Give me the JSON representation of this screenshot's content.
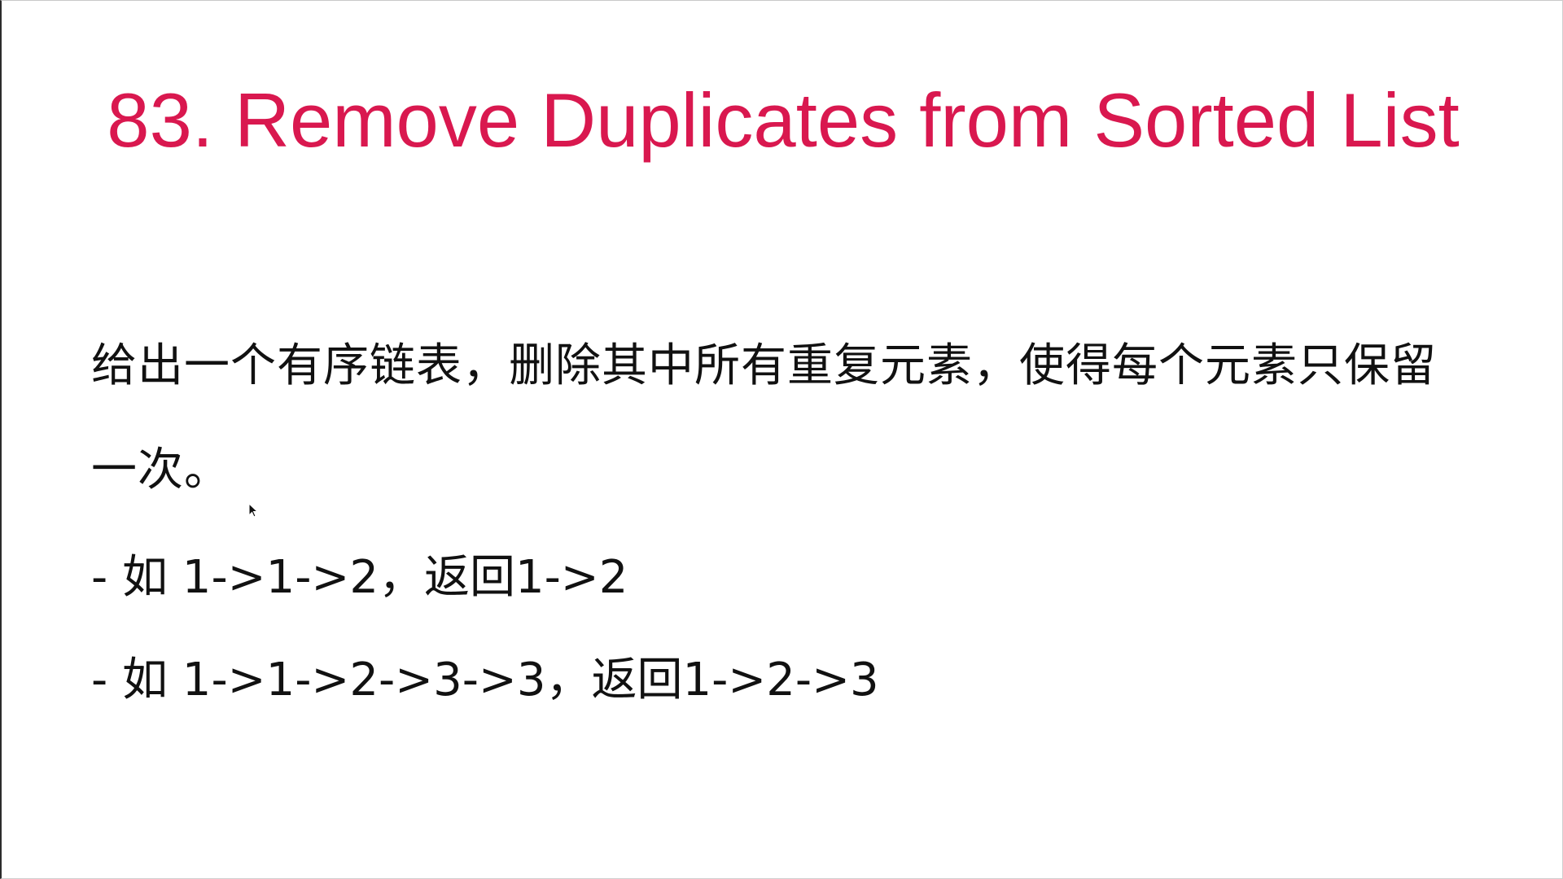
{
  "slide": {
    "title": "83. Remove Duplicates from Sorted List",
    "description": "给出一个有序链表，删除其中所有重复元素，使得每个元素只保留一次。",
    "examples": [
      "- 如 1->1->2，返回1->2",
      "- 如 1->1->2->3->3，返回1->2->3"
    ]
  },
  "colors": {
    "title": "#d9184f",
    "text": "#111111",
    "background": "#ffffff"
  },
  "icons": {
    "pointer": "mouse-pointer-icon"
  }
}
